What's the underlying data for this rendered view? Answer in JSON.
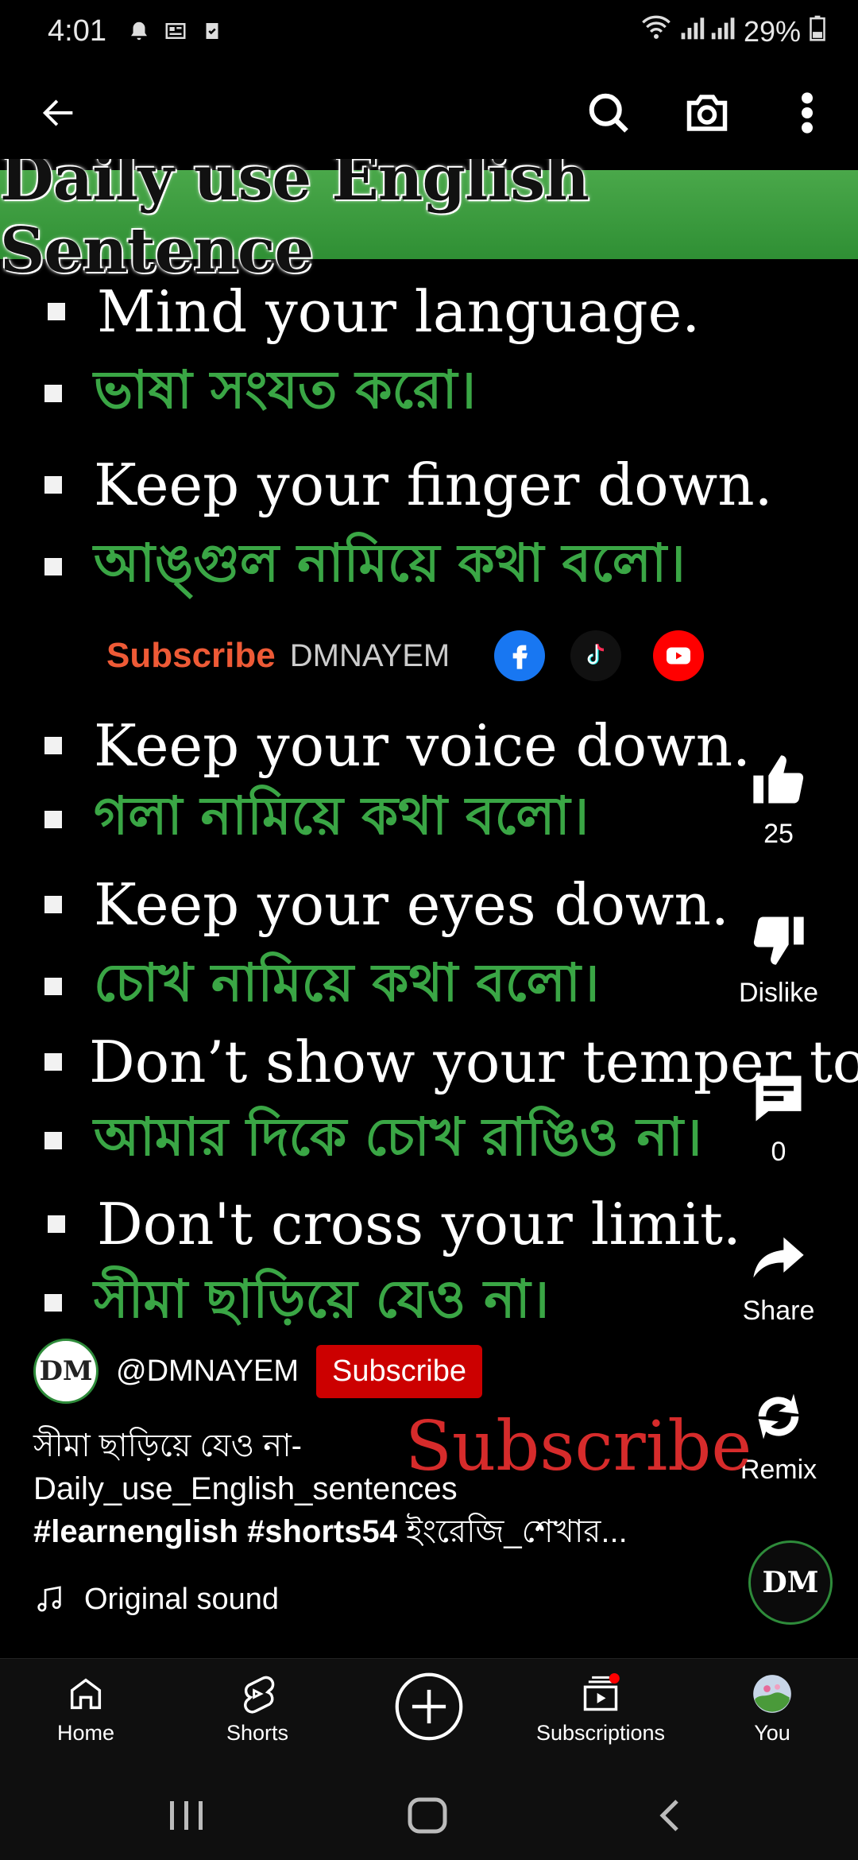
{
  "status": {
    "time": "4:01",
    "battery": "29%"
  },
  "banner": "Daily use English Sentence",
  "sentences": [
    {
      "en": "Mind your language.",
      "bn": "ভাষা সংযত করো।"
    },
    {
      "en": "Keep your finger down.",
      "bn": "আঙ্গুল নামিয়ে কথা বলো।"
    },
    {
      "en": "Keep your voice down.",
      "bn": "গলা নামিয়ে কথা বলো।"
    },
    {
      "en": "Keep your eyes down.",
      "bn": "চোখ নামিয়ে কথা বলো।"
    },
    {
      "en": "Don’t show your temper to me.",
      "bn": "আমার দিকে চোখ রাঙিও না।"
    },
    {
      "en": "Don't cross your limit.",
      "bn": "সীমা ছাড়িয়ে যেও না।"
    }
  ],
  "promo": {
    "subscribe": "Subscribe",
    "name": "DMNAYEM"
  },
  "actions": {
    "likes": "25",
    "dislike": "Dislike",
    "comments": "0",
    "share": "Share",
    "remix": "Remix"
  },
  "channel": {
    "handle": "@DMNAYEM",
    "subscribe": "Subscribe",
    "avatar_text": "DM"
  },
  "overlay_subscribe": "Subscribe",
  "caption": {
    "line1": "সীমা ছাড়িয়ে যেও না-",
    "line2": "Daily_use_English_sentences",
    "tags": "#learnenglish #shorts54",
    "rest": " ইংরেজি_শেখার..."
  },
  "sound": "Original sound",
  "nav": {
    "home": "Home",
    "shorts": "Shorts",
    "subscriptions": "Subscriptions",
    "you": "You"
  },
  "colors": {
    "green": "#3aa645",
    "red": "#cc0000",
    "banner": "#3f9e43"
  }
}
